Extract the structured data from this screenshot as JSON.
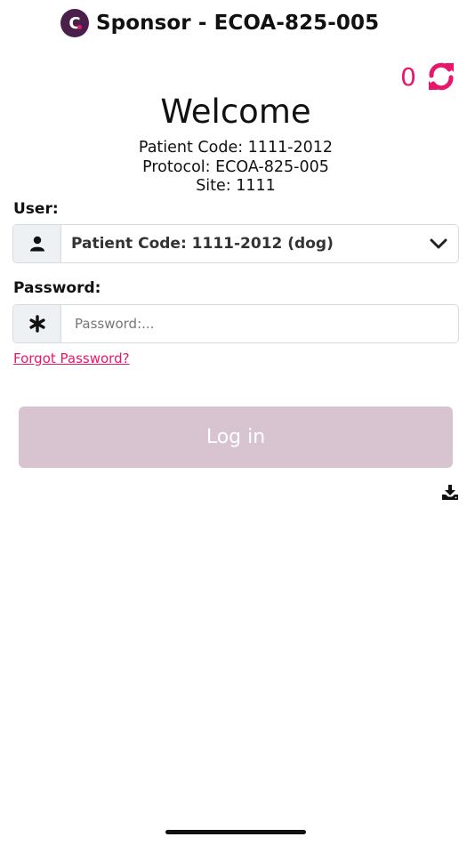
{
  "header": {
    "logo_letter": "C",
    "title": "Sponsor - ECOA-825-005"
  },
  "sync": {
    "count": "0",
    "icon": "sync-icon",
    "color": "#e8176b"
  },
  "welcome": {
    "title": "Welcome",
    "patient_code": "Patient Code: 1111-2012",
    "protocol": "Protocol: ECOA-825-005",
    "site": "Site: 1111"
  },
  "user_field": {
    "label": "User:",
    "icon": "user-icon",
    "selected": "Patient Code: 1111-2012 (dog)",
    "dropdown_icon": "chevron-down-icon"
  },
  "password_field": {
    "label": "Password:",
    "icon": "asterisk-icon",
    "value": "",
    "placeholder": "Password:..."
  },
  "forgot_password": "Forgot Password?",
  "login_button": {
    "label": "Log in",
    "color": "#d8c4d1"
  },
  "download_icon": "download-icon",
  "colors": {
    "accent": "#e8176b",
    "brand": "#4a1f4a"
  }
}
